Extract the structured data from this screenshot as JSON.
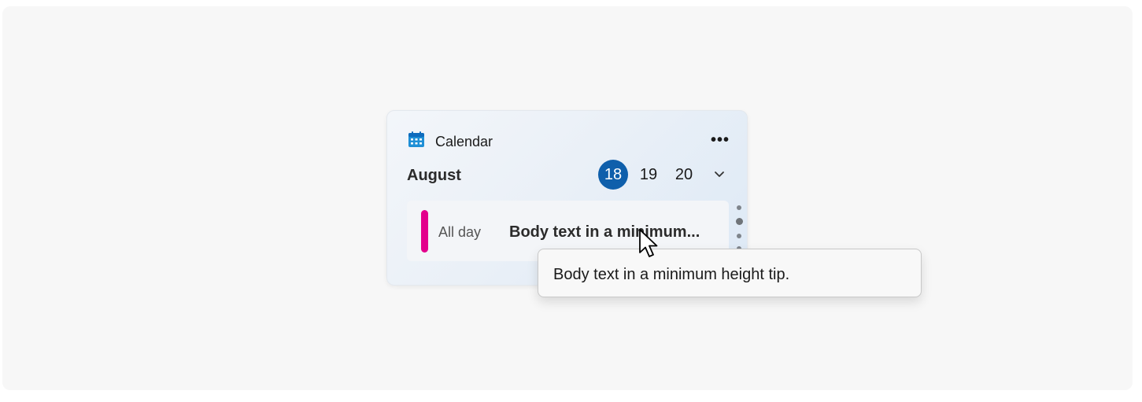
{
  "widget": {
    "app_icon": "calendar-icon",
    "app_title": "Calendar",
    "more_icon": "more-horizontal-icon",
    "more_label": "•••",
    "month": "August",
    "days": [
      "18",
      "19",
      "20"
    ],
    "selected_day": "18",
    "expand_icon": "chevron-down-icon",
    "event": {
      "time": "All day",
      "title": "Body text in a minimum...",
      "color": "#e3008c"
    },
    "pager": {
      "count": 4,
      "active_index": 1
    }
  },
  "tooltip": {
    "text": "Body text in a minimum height tip."
  },
  "cursor_icon": "mouse-pointer-icon",
  "colors": {
    "accent": "#0f5fab",
    "event_bar": "#e3008c"
  }
}
